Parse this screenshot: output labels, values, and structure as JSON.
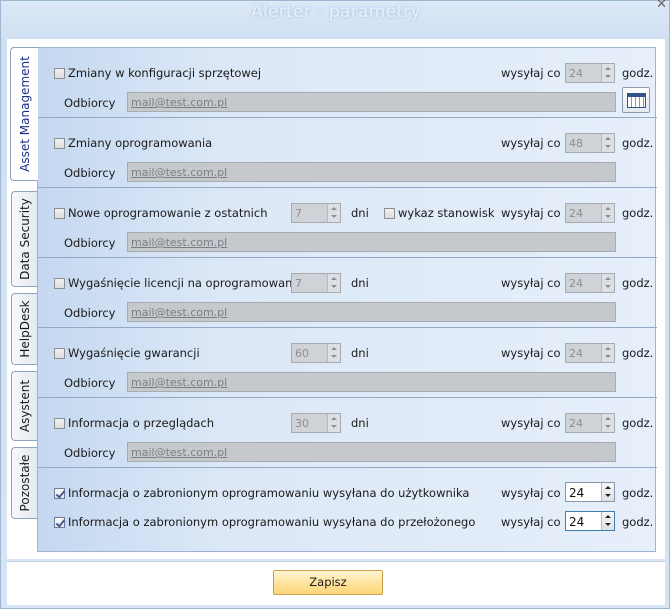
{
  "window": {
    "title": "Alerter - parametry",
    "close_glyph": "✕"
  },
  "tabs": [
    {
      "label": "Asset Management",
      "active": true
    },
    {
      "label": "Data Security",
      "active": false
    },
    {
      "label": "HelpDesk",
      "active": false
    },
    {
      "label": "Asystent",
      "active": false
    },
    {
      "label": "Pozostałe",
      "active": false
    }
  ],
  "common": {
    "sends_every": "wysyłaj co",
    "hours": "godz.",
    "days": "dni",
    "recipients": "Odbiorcy",
    "email": "mail@test.com.pl"
  },
  "sections": [
    {
      "label": "Zmiany w konfiguracji sprzętowej",
      "checked": false,
      "hours": "24"
    },
    {
      "label": "Zmiany oprogramowania",
      "checked": false,
      "hours": "48"
    },
    {
      "label": "Nowe oprogramowanie z ostatnich",
      "checked": false,
      "days": "7",
      "extra_label": "wykaz stanowisk",
      "extra_checked": false,
      "hours": "24"
    },
    {
      "label": "Wygaśnięcie licencji na oprogramowanie",
      "checked": false,
      "days": "7",
      "hours": "24"
    },
    {
      "label": "Wygaśnięcie gwarancji",
      "checked": false,
      "days": "60",
      "hours": "24"
    },
    {
      "label": "Informacja o przeglądach",
      "checked": false,
      "days": "30",
      "hours": "24"
    }
  ],
  "forbidden": [
    {
      "label": "Informacja o zabronionym oprogramowaniu wysyłana do użytkownika",
      "checked": true,
      "hours": "24"
    },
    {
      "label": "Informacja o zabronionym oprogramowaniu wysyłana do przełożonego",
      "checked": true,
      "hours": "24"
    }
  ],
  "icons": {
    "calendar": "calendar-icon"
  },
  "footer": {
    "save_label": "Zapisz"
  },
  "colors": {
    "accent": "#ffe29a",
    "panel": "#dce8f7",
    "tab_active_text": "#1d2f8a"
  }
}
